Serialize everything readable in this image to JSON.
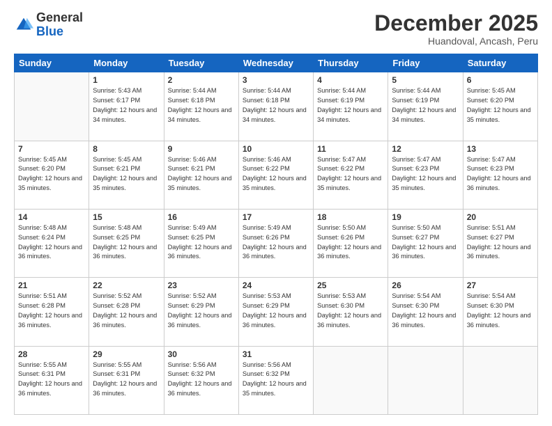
{
  "header": {
    "logo_general": "General",
    "logo_blue": "Blue",
    "month": "December 2025",
    "location": "Huandoval, Ancash, Peru"
  },
  "days_of_week": [
    "Sunday",
    "Monday",
    "Tuesday",
    "Wednesday",
    "Thursday",
    "Friday",
    "Saturday"
  ],
  "weeks": [
    [
      {
        "day": "",
        "empty": true
      },
      {
        "day": "1",
        "sunrise": "5:43 AM",
        "sunset": "6:17 PM",
        "daylight": "12 hours and 34 minutes."
      },
      {
        "day": "2",
        "sunrise": "5:44 AM",
        "sunset": "6:18 PM",
        "daylight": "12 hours and 34 minutes."
      },
      {
        "day": "3",
        "sunrise": "5:44 AM",
        "sunset": "6:18 PM",
        "daylight": "12 hours and 34 minutes."
      },
      {
        "day": "4",
        "sunrise": "5:44 AM",
        "sunset": "6:19 PM",
        "daylight": "12 hours and 34 minutes."
      },
      {
        "day": "5",
        "sunrise": "5:44 AM",
        "sunset": "6:19 PM",
        "daylight": "12 hours and 34 minutes."
      },
      {
        "day": "6",
        "sunrise": "5:45 AM",
        "sunset": "6:20 PM",
        "daylight": "12 hours and 35 minutes."
      }
    ],
    [
      {
        "day": "7",
        "sunrise": "5:45 AM",
        "sunset": "6:20 PM",
        "daylight": "12 hours and 35 minutes."
      },
      {
        "day": "8",
        "sunrise": "5:45 AM",
        "sunset": "6:21 PM",
        "daylight": "12 hours and 35 minutes."
      },
      {
        "day": "9",
        "sunrise": "5:46 AM",
        "sunset": "6:21 PM",
        "daylight": "12 hours and 35 minutes."
      },
      {
        "day": "10",
        "sunrise": "5:46 AM",
        "sunset": "6:22 PM",
        "daylight": "12 hours and 35 minutes."
      },
      {
        "day": "11",
        "sunrise": "5:47 AM",
        "sunset": "6:22 PM",
        "daylight": "12 hours and 35 minutes."
      },
      {
        "day": "12",
        "sunrise": "5:47 AM",
        "sunset": "6:23 PM",
        "daylight": "12 hours and 35 minutes."
      },
      {
        "day": "13",
        "sunrise": "5:47 AM",
        "sunset": "6:23 PM",
        "daylight": "12 hours and 36 minutes."
      }
    ],
    [
      {
        "day": "14",
        "sunrise": "5:48 AM",
        "sunset": "6:24 PM",
        "daylight": "12 hours and 36 minutes."
      },
      {
        "day": "15",
        "sunrise": "5:48 AM",
        "sunset": "6:25 PM",
        "daylight": "12 hours and 36 minutes."
      },
      {
        "day": "16",
        "sunrise": "5:49 AM",
        "sunset": "6:25 PM",
        "daylight": "12 hours and 36 minutes."
      },
      {
        "day": "17",
        "sunrise": "5:49 AM",
        "sunset": "6:26 PM",
        "daylight": "12 hours and 36 minutes."
      },
      {
        "day": "18",
        "sunrise": "5:50 AM",
        "sunset": "6:26 PM",
        "daylight": "12 hours and 36 minutes."
      },
      {
        "day": "19",
        "sunrise": "5:50 AM",
        "sunset": "6:27 PM",
        "daylight": "12 hours and 36 minutes."
      },
      {
        "day": "20",
        "sunrise": "5:51 AM",
        "sunset": "6:27 PM",
        "daylight": "12 hours and 36 minutes."
      }
    ],
    [
      {
        "day": "21",
        "sunrise": "5:51 AM",
        "sunset": "6:28 PM",
        "daylight": "12 hours and 36 minutes."
      },
      {
        "day": "22",
        "sunrise": "5:52 AM",
        "sunset": "6:28 PM",
        "daylight": "12 hours and 36 minutes."
      },
      {
        "day": "23",
        "sunrise": "5:52 AM",
        "sunset": "6:29 PM",
        "daylight": "12 hours and 36 minutes."
      },
      {
        "day": "24",
        "sunrise": "5:53 AM",
        "sunset": "6:29 PM",
        "daylight": "12 hours and 36 minutes."
      },
      {
        "day": "25",
        "sunrise": "5:53 AM",
        "sunset": "6:30 PM",
        "daylight": "12 hours and 36 minutes."
      },
      {
        "day": "26",
        "sunrise": "5:54 AM",
        "sunset": "6:30 PM",
        "daylight": "12 hours and 36 minutes."
      },
      {
        "day": "27",
        "sunrise": "5:54 AM",
        "sunset": "6:30 PM",
        "daylight": "12 hours and 36 minutes."
      }
    ],
    [
      {
        "day": "28",
        "sunrise": "5:55 AM",
        "sunset": "6:31 PM",
        "daylight": "12 hours and 36 minutes."
      },
      {
        "day": "29",
        "sunrise": "5:55 AM",
        "sunset": "6:31 PM",
        "daylight": "12 hours and 36 minutes."
      },
      {
        "day": "30",
        "sunrise": "5:56 AM",
        "sunset": "6:32 PM",
        "daylight": "12 hours and 36 minutes."
      },
      {
        "day": "31",
        "sunrise": "5:56 AM",
        "sunset": "6:32 PM",
        "daylight": "12 hours and 35 minutes."
      },
      {
        "day": "",
        "empty": true
      },
      {
        "day": "",
        "empty": true
      },
      {
        "day": "",
        "empty": true
      }
    ]
  ]
}
